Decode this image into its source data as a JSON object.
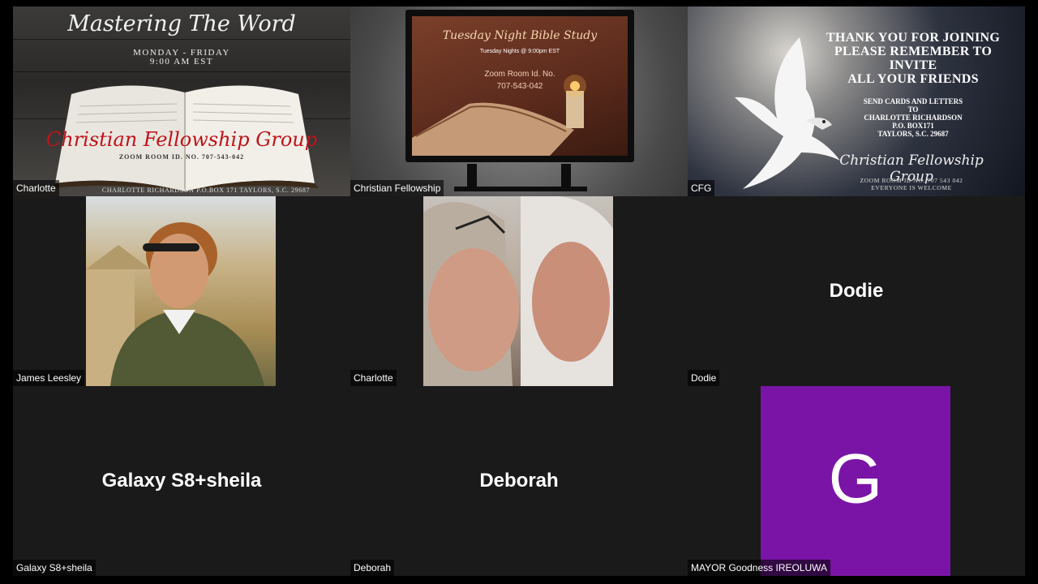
{
  "meeting": {
    "tiles": [
      {
        "name": "Charlotte",
        "content": {
          "title": "Mastering The Word",
          "days": "MONDAY - FRIDAY",
          "time": "9:00 AM EST",
          "group": "Christian Fellowship Group",
          "zoom_id": "ZOOM ROOM ID. NO. 707-543-042",
          "address": "CHARLOTTE RICHARDSON    P.O.BOX 171    TAYLORS, S.C. 29687"
        }
      },
      {
        "name": "Christian Fellowship",
        "content": {
          "title": "Tuesday Night Bible Study",
          "schedule": "Tuesday Nights @ 9:00pm EST",
          "room_label": "Zoom Room Id. No.",
          "room_id": "707-543-042"
        }
      },
      {
        "name": "CFG",
        "content": {
          "headline": "THANK YOU FOR JOINING PLEASE REMEMBER TO INVITE ALL YOUR FRIENDS",
          "headline_lines": [
            "THANK YOU FOR JOINING",
            "PLEASE REMEMBER TO",
            "INVITE",
            "ALL YOUR FRIENDS"
          ],
          "mail_lines": [
            "SEND CARDS AND LETTERS",
            "TO",
            "CHARLOTTE RICHARDSON",
            "P.O. BOX171",
            "TAYLORS, S.C. 29687"
          ],
          "group": "Christian Fellowship Group",
          "zoom_id": "ZOOM ROOM ID NO. 707 543 042",
          "welcome": "EVERYONE IS WELCOME"
        }
      },
      {
        "name": "James Leesley",
        "type": "photo"
      },
      {
        "name": "Charlotte",
        "type": "photo"
      },
      {
        "name": "Dodie",
        "type": "camera-off",
        "display": "Dodie"
      },
      {
        "name": "Galaxy S8+sheila",
        "type": "camera-off",
        "display": "Galaxy S8+sheila"
      },
      {
        "name": "Deborah",
        "type": "camera-off",
        "display": "Deborah"
      },
      {
        "name": "MAYOR Goodness IREOLUWA",
        "type": "avatar",
        "initial": "G",
        "avatar_color": "#7a14a6"
      }
    ]
  }
}
